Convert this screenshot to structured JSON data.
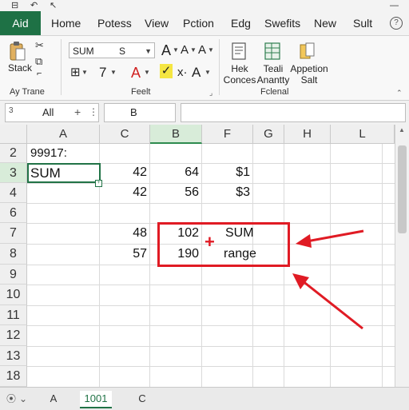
{
  "menu": {
    "file_tab": "Aid",
    "items": [
      "Home",
      "Potess",
      "View",
      "Pction",
      "Edg",
      "Swefits",
      "New",
      "Sult"
    ]
  },
  "ribbon": {
    "stack_label": "Stack",
    "font_box": {
      "name": "SUM",
      "size": "S"
    },
    "big_buttons": [
      {
        "lines": [
          "Hek",
          "Conces"
        ]
      },
      {
        "lines": [
          "Teali",
          "Anantty"
        ]
      },
      {
        "lines": [
          "Appetion",
          "Salt"
        ]
      }
    ],
    "group_labels": [
      "Ay Trane",
      "Feelt",
      "Fclenal"
    ]
  },
  "formula_bar": {
    "name_box": "All",
    "col_label": "B"
  },
  "grid": {
    "columns": [
      "A",
      "C",
      "B",
      "F",
      "G",
      "H",
      "L"
    ],
    "selected_column": "B",
    "rows": [
      "2",
      "3",
      "4",
      "6",
      "7",
      "8",
      "9",
      "10",
      "11",
      "12",
      "13",
      "18"
    ],
    "selected_row": "3",
    "cells": {
      "r2_a": "99917:",
      "r3_a": "SUM",
      "r3_c": "42",
      "r3_b": "64",
      "r3_f": "$1",
      "r4_c": "42",
      "r4_b": "56",
      "r4_f": "$3",
      "r7_c": "48",
      "r7_b": "102",
      "r7_f": "SUM",
      "r8_c": "57",
      "r8_b": "190",
      "r8_f": "range"
    },
    "annotation_plus": "+"
  },
  "sheet_tabs": [
    "A",
    "1001",
    "C"
  ],
  "active_tab": "1001",
  "colors": {
    "accent": "#217346",
    "highlight": "#e01b24"
  }
}
